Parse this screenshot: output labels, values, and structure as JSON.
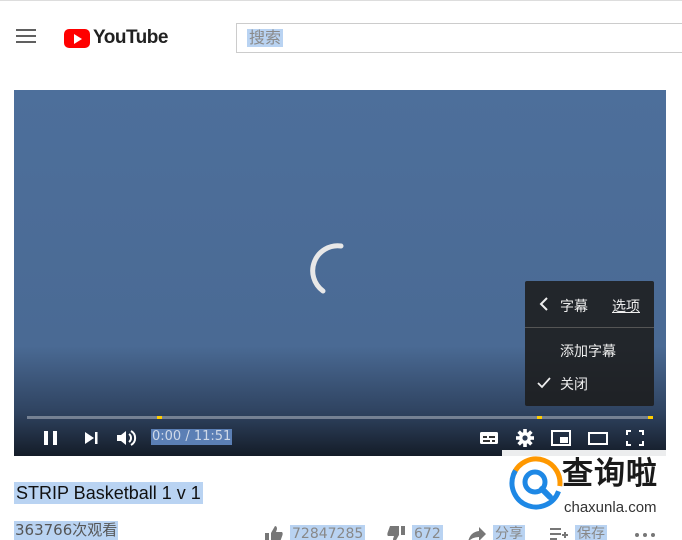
{
  "header": {
    "logo_text": "YouTube",
    "search_placeholder": "搜索"
  },
  "player": {
    "subtitles_menu": {
      "title": "字幕",
      "options_link": "选项",
      "items": [
        "添加字幕",
        "关闭"
      ],
      "checked_item": "关闭"
    },
    "time_display": "0:00 / 11:51",
    "progress_fraction": 0.0,
    "status": "loading"
  },
  "video": {
    "title": "STRIP Basketball 1 v 1",
    "views": "363766次观看",
    "likes": "72847285",
    "dislikes": "672",
    "share_label": "分享",
    "save_label": "保存"
  },
  "watermark": {
    "brand": "查询啦",
    "url": "chaxunla.com"
  },
  "colors": {
    "brand_red": "#ff0000",
    "player_background": "#4d6f9b",
    "selection_highlight": "#b9d3f2",
    "progress_marker": "#ffcc00"
  }
}
